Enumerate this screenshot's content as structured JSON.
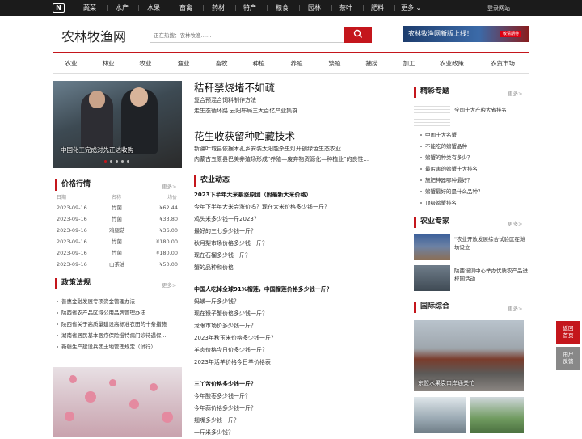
{
  "topbar": {
    "logo_text": "N",
    "nav": [
      "蔬菜",
      "水产",
      "水果",
      "畜禽",
      "药材",
      "特产",
      "粮食",
      "园林",
      "茶叶",
      "肥料",
      "更多"
    ],
    "login": "登录网站"
  },
  "header": {
    "site_title": "农林牧渔网",
    "search_placeholder": "正在热搜：农林牧渔……",
    "banner_text": "农林牧渔网新版上线！",
    "banner_tag": "敬请期待"
  },
  "categories": [
    "农业",
    "林业",
    "牧业",
    "渔业",
    "畜牧",
    "种植",
    "养殖",
    "繁殖",
    "捕捞",
    "加工",
    "农业政策",
    "农贸市场"
  ],
  "hero": {
    "caption": "中国化工完成对先正达收购"
  },
  "prices": {
    "title": "价格行情",
    "more": "更多>",
    "cols": [
      "日期",
      "名称",
      "均价"
    ],
    "rows": [
      {
        "date": "2023-09-16",
        "name": "竹菌",
        "price": "¥62.44"
      },
      {
        "date": "2023-09-16",
        "name": "竹菌",
        "price": "¥33.80"
      },
      {
        "date": "2023-09-16",
        "name": "鸡腿菇",
        "price": "¥36.00"
      },
      {
        "date": "2023-09-16",
        "name": "竹菌",
        "price": "¥180.00"
      },
      {
        "date": "2023-09-16",
        "name": "竹菌",
        "price": "¥180.00"
      },
      {
        "date": "2023-09-16",
        "name": "山茶油",
        "price": "¥50.00"
      }
    ]
  },
  "policy": {
    "title": "政策法规",
    "more": "更多>",
    "items": [
      "普惠金融发展专项资金管理办法",
      "陕西省农产品区域公用品牌管理办法",
      "陕西省关于高质量建设高标准农田的十条措施",
      "湖南省居民基本医疗保险慢特病门诊待遇保...",
      "新疆生产建设兵团土地管理规定（试行）"
    ]
  },
  "main": {
    "headline1": "秸秆禁烧堵不如疏",
    "sub1": "复合预混合饲料制作方法",
    "sub1b": "走生态循环路 云阳布局三大百亿产业集群",
    "headline2": "花生收获留种贮藏技术",
    "sub2a": "新疆叶城县依据木孔乡安装太阳能杀虫灯开创绿色生态农业",
    "sub2b": "内蒙古五原县巴美养殖场形成\"养殖—废弃物资源化—种植业\"的良性...",
    "section": "农业动态",
    "group1": [
      "2023下半年大米暴涨原因（附最新大米价格）",
      "今年下半年大米会涨价吗？现在大米价格多少钱一斤？",
      "鸡头米多少钱一斤2023？",
      "最好的三七多少钱一斤？",
      "秋月梨市场价格多少钱一斤？",
      "现在石榴多少钱一斤？",
      "蟹的品种和价格"
    ],
    "group2": [
      "中国人吃掉全球91%榴莲，中国榴莲价格多少钱一斤？",
      "蚂蟥一斤多少钱？",
      "现在猴子蟹价格多少钱一斤？",
      "龙眼市场价多少钱一斤？",
      "2023年秋玉米价格多少钱一斤？",
      "羊肉价格今日价多少钱一斤？",
      "2023年活羊价格今日羊价格表"
    ],
    "group3": [
      "三丫苦价格多少钱一斤？",
      "今年酸枣多少钱一斤？",
      "今年蒜价格多少钱一斤？",
      "翘嘴多少钱一斤？",
      "一斤米多少钱？"
    ]
  },
  "right": {
    "featured": {
      "title": "精彩专题",
      "more": "更多>",
      "top_item": "全国十大产粮大省排名",
      "items": [
        "中国十大名蟹",
        "不能吃的螃蟹品种",
        "螃蟹的种类有多少？",
        "最厉害的螃蟹十大排名",
        "施肥神器哪种最好？",
        "螃蟹最好的是什么品种？",
        "顶级螃蟹排名"
      ]
    },
    "experts": {
      "title": "农业专家",
      "more": "更多>",
      "items": [
        "\"农业开放发展综合试验区在潍坊设立",
        "陕西培训中心举办优质农产品进校园活动"
      ]
    },
    "intl": {
      "title": "国际综合",
      "more": "更多>",
      "caption": "东盟水果袁口岸通关忙"
    }
  },
  "float": {
    "top": [
      "返回",
      "首页"
    ],
    "feedback": [
      "用户",
      "反馈"
    ]
  }
}
